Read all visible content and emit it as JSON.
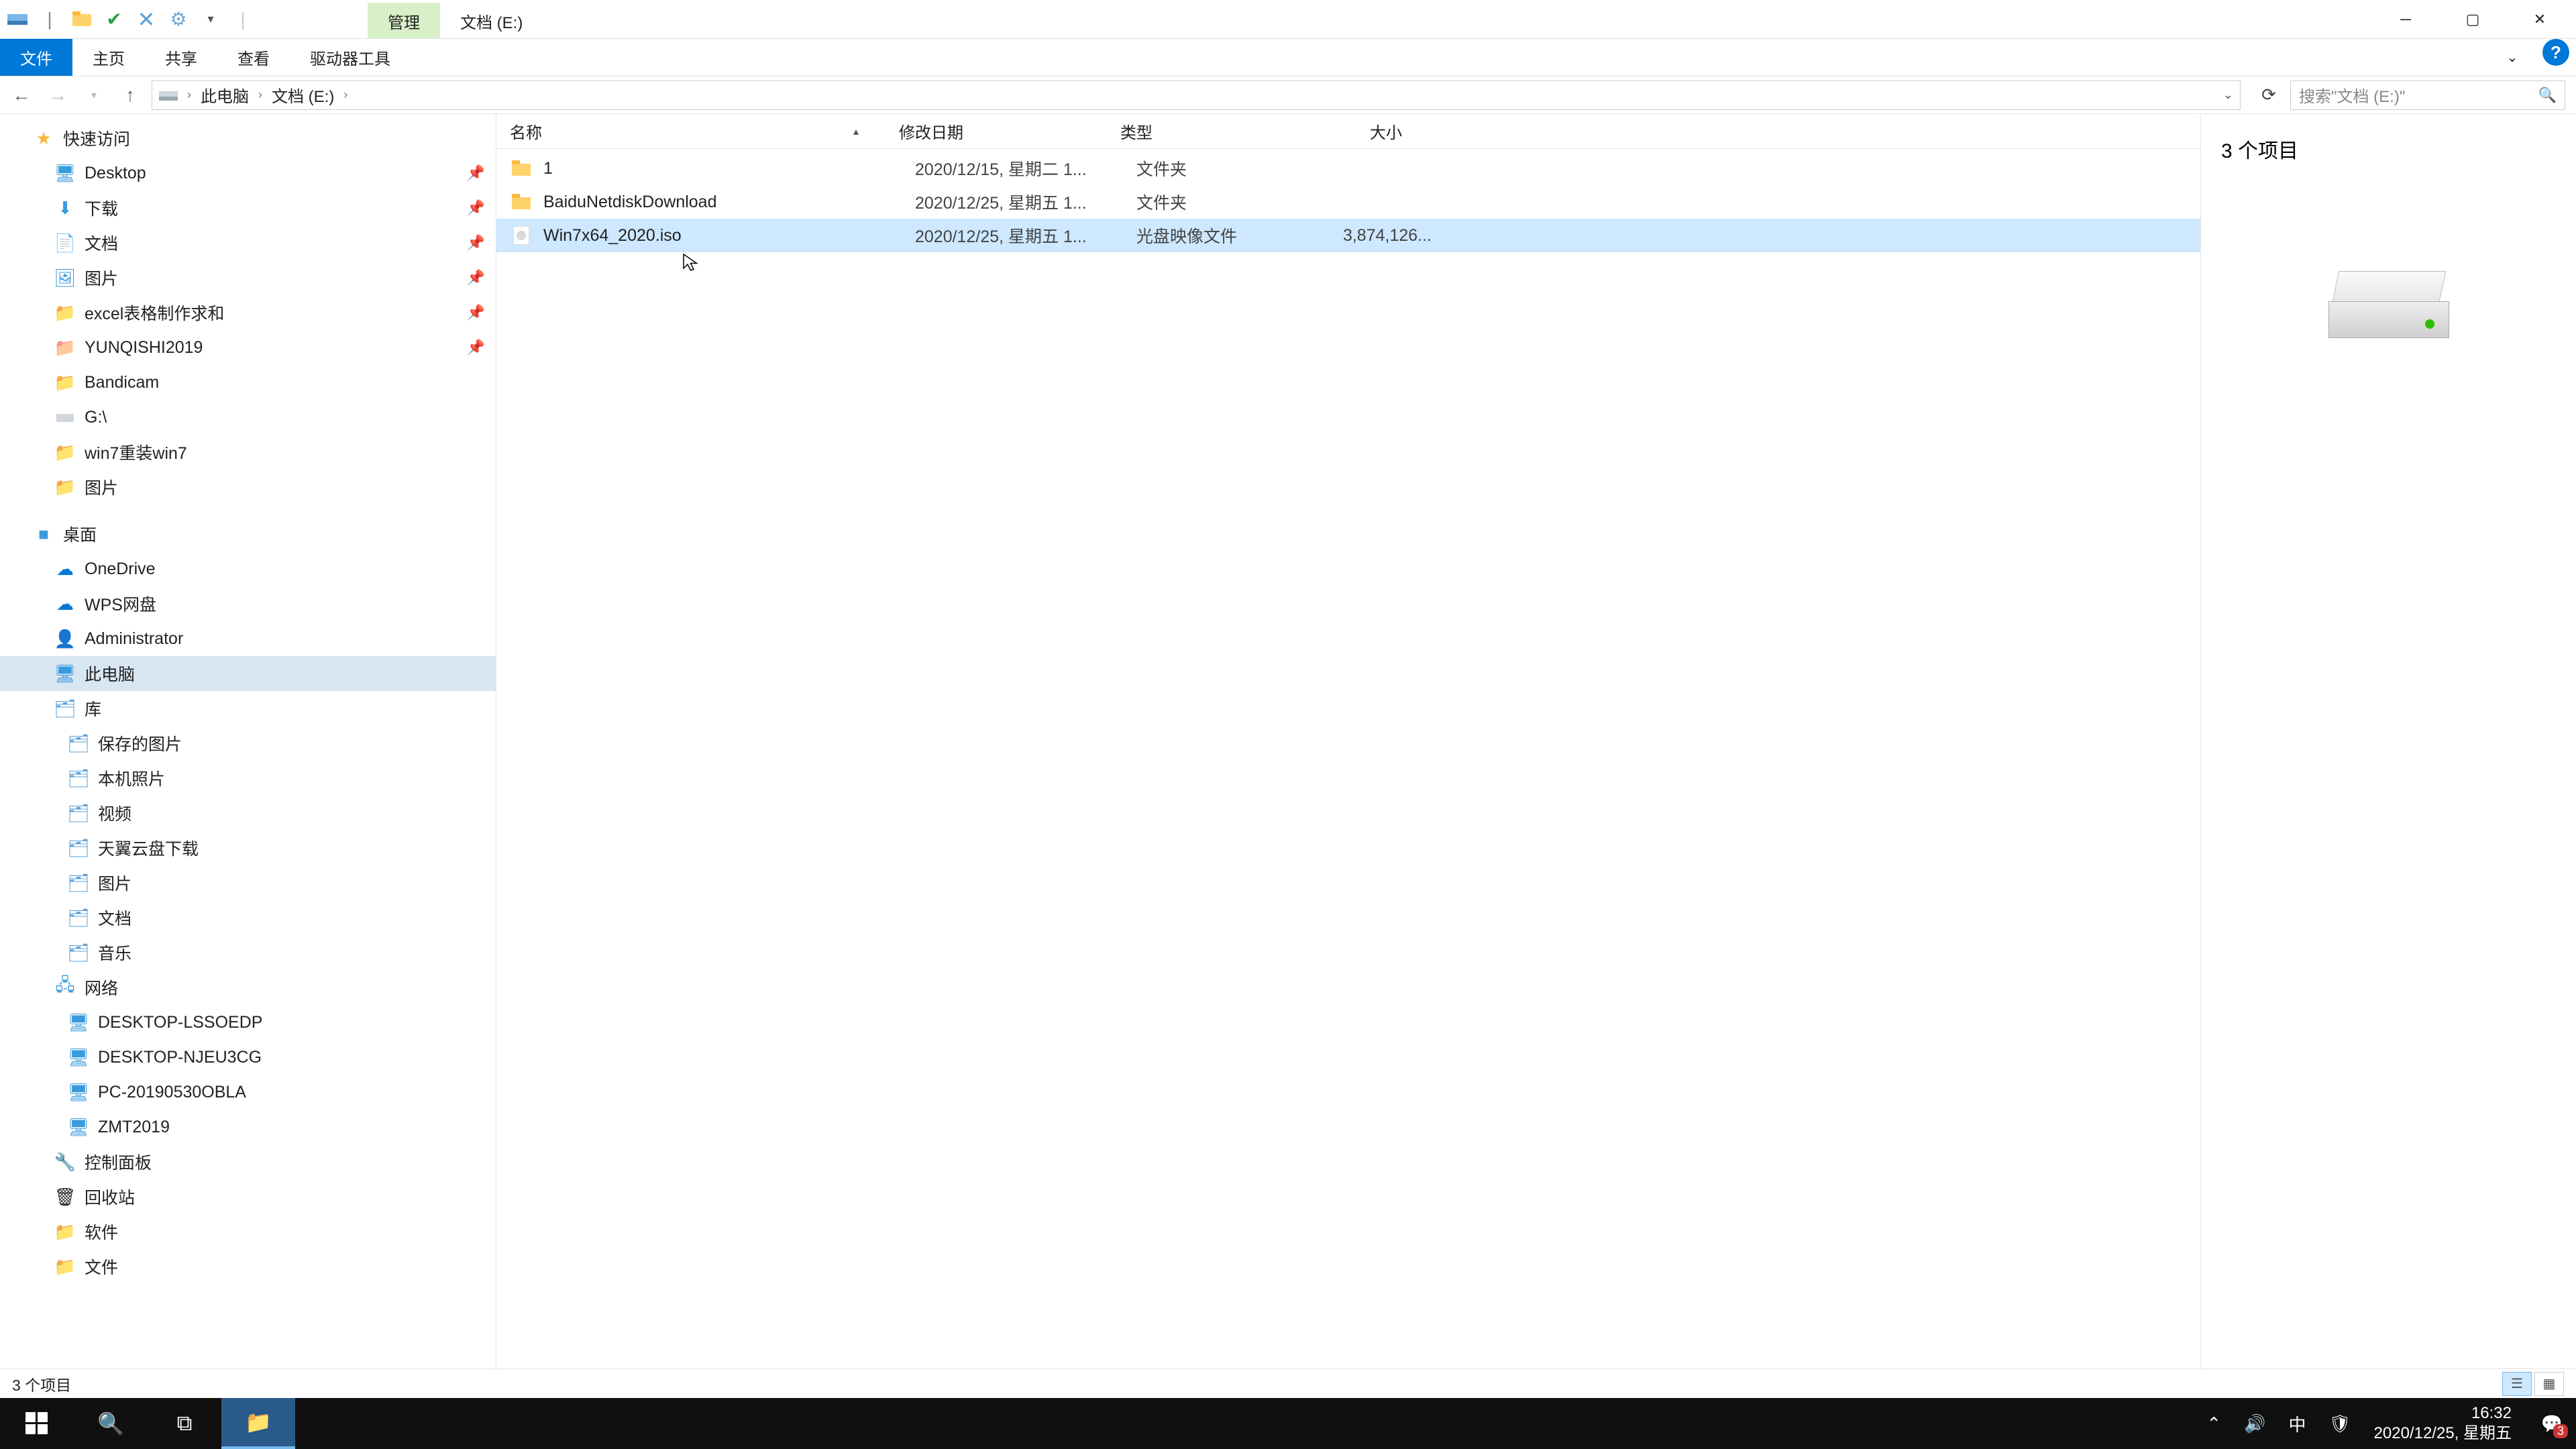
{
  "title": {
    "management_tab": "管理",
    "location_tab": "文档 (E:)"
  },
  "ribbon": {
    "file": "文件",
    "home": "主页",
    "share": "共享",
    "view": "查看",
    "drive": "驱动器工具"
  },
  "breadcrumb": [
    "此电脑",
    "文档 (E:)"
  ],
  "search_placeholder": "搜索\"文档 (E:)\"",
  "columns": {
    "name": "名称",
    "date": "修改日期",
    "type": "类型",
    "size": "大小"
  },
  "preview": {
    "title": "3 个项目"
  },
  "statusbar_text": "3 个项目",
  "files": [
    {
      "name": "1",
      "date": "2020/12/15, 星期二 1...",
      "type": "文件夹",
      "size": "",
      "icon": "folder"
    },
    {
      "name": "BaiduNetdiskDownload",
      "date": "2020/12/25, 星期五 1...",
      "type": "文件夹",
      "size": "",
      "icon": "folder"
    },
    {
      "name": "Win7x64_2020.iso",
      "date": "2020/12/25, 星期五 1...",
      "type": "光盘映像文件",
      "size": "3,874,126...",
      "icon": "iso",
      "selected": true
    }
  ],
  "tree": {
    "quick_access": "快速访问",
    "quick_items": [
      {
        "label": "Desktop",
        "icon": "desktop"
      },
      {
        "label": "下载",
        "icon": "down"
      },
      {
        "label": "文档",
        "icon": "doc"
      },
      {
        "label": "图片",
        "icon": "pic"
      },
      {
        "label": "excel表格制作求和",
        "icon": "folder"
      },
      {
        "label": "YUNQISHI2019",
        "icon": "folder-red"
      },
      {
        "label": "Bandicam",
        "icon": "folder"
      },
      {
        "label": "G:\\",
        "icon": "drive"
      },
      {
        "label": "win7重装win7",
        "icon": "folder"
      },
      {
        "label": "图片",
        "icon": "pic"
      }
    ],
    "desktop": "桌面",
    "desktop_items": [
      "OneDrive",
      "WPS网盘",
      "Administrator",
      "此电脑",
      "库"
    ],
    "library_items": [
      "保存的图片",
      "本机照片",
      "视频",
      "天翼云盘下载",
      "图片",
      "文档",
      "音乐"
    ],
    "network": "网络",
    "network_items": [
      "DESKTOP-LSSOEDP",
      "DESKTOP-NJEU3CG",
      "PC-20190530OBLA",
      "ZMT2019"
    ],
    "panel": "控制面板",
    "recycle": "回收站",
    "soft": "软件",
    "file_folder": "文件"
  },
  "tray": {
    "ime": "中",
    "time": "16:32",
    "date": "2020/12/25, 星期五",
    "notif_count": "3"
  },
  "colors": {
    "accent": "#0078d7",
    "select": "#cde8ff",
    "ribbon_accent": "#d8f0c8",
    "taskbar": "#101010"
  }
}
